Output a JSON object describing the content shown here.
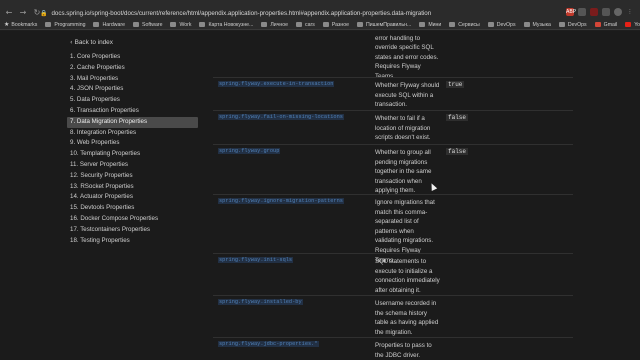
{
  "browser": {
    "url": "docs.spring.io/spring-boot/docs/current/reference/html/appendix.application-properties.html#appendix.application-properties.data-migration",
    "extensions": [
      "ABP",
      "ext",
      "ext",
      "ext"
    ]
  },
  "bookmarks": [
    {
      "label": "Bookmarks",
      "icon": "star-icon"
    },
    {
      "label": "Programming",
      "icon": "folder-icon"
    },
    {
      "label": "Hardware",
      "icon": "folder-icon"
    },
    {
      "label": "Software",
      "icon": "folder-icon"
    },
    {
      "label": "Work",
      "icon": "folder-icon"
    },
    {
      "label": "Карта Новокузне...",
      "icon": "folder-icon"
    },
    {
      "label": "Личное",
      "icon": "folder-icon"
    },
    {
      "label": "cars",
      "icon": "folder-icon"
    },
    {
      "label": "Разное",
      "icon": "folder-icon"
    },
    {
      "label": "ПишемПравильн...",
      "icon": "folder-icon"
    },
    {
      "label": "Мини",
      "icon": "folder-icon"
    },
    {
      "label": "Сервисы",
      "icon": "folder-icon"
    },
    {
      "label": "DevOps",
      "icon": "folder-icon"
    },
    {
      "label": "Музыка",
      "icon": "folder-icon"
    },
    {
      "label": "DevOps",
      "icon": "folder-icon"
    },
    {
      "label": "Gmail",
      "icon": "gmail-icon"
    },
    {
      "label": "YouTube",
      "icon": "youtube-icon"
    },
    {
      "label": "Карты",
      "icon": "maps-icon"
    }
  ],
  "sidebar": {
    "back_label": "Back to index",
    "items": [
      "1. Core Properties",
      "2. Cache Properties",
      "3. Mail Properties",
      "4. JSON Properties",
      "5. Data Properties",
      "6. Transaction Properties",
      "7. Data Migration Properties",
      "8. Integration Properties",
      "9. Web Properties",
      "10. Templating Properties",
      "11. Server Properties",
      "12. Security Properties",
      "13. RSocket Properties",
      "14. Actuator Properties",
      "15. Devtools Properties",
      "16. Docker Compose Properties",
      "17. Testcontainers Properties",
      "18. Testing Properties"
    ],
    "active_index": 6
  },
  "rows": [
    {
      "prop": "spring.flyway.error-overrides",
      "desc": "Rules for the built-in error handling to override specific SQL states and error codes. Requires Flyway Teams.",
      "default": ""
    },
    {
      "prop": "spring.flyway.execute-in-transaction",
      "desc": "Whether Flyway should execute SQL within a transaction.",
      "default": "true"
    },
    {
      "prop": "spring.flyway.fail-on-missing-locations",
      "desc": "Whether to fail if a location of migration scripts doesn't exist.",
      "default": "false"
    },
    {
      "prop": "spring.flyway.group",
      "desc": "Whether to group all pending migrations together in the same transaction when applying them.",
      "default": "false"
    },
    {
      "prop": "spring.flyway.ignore-migration-patterns",
      "desc": "Ignore migrations that match this comma-separated list of patterns when validating migrations. Requires Flyway Teams.",
      "default": ""
    },
    {
      "prop": "spring.flyway.init-sqls",
      "desc": "SQL statements to execute to initialize a connection immediately after obtaining it.",
      "default": ""
    },
    {
      "prop": "spring.flyway.installed-by",
      "desc": "Username recorded in the schema history table as having applied the migration.",
      "default": ""
    },
    {
      "prop": "spring.flyway.jdbc-properties.*",
      "desc": "Properties to pass to the JDBC driver. Requires",
      "default": ""
    }
  ]
}
